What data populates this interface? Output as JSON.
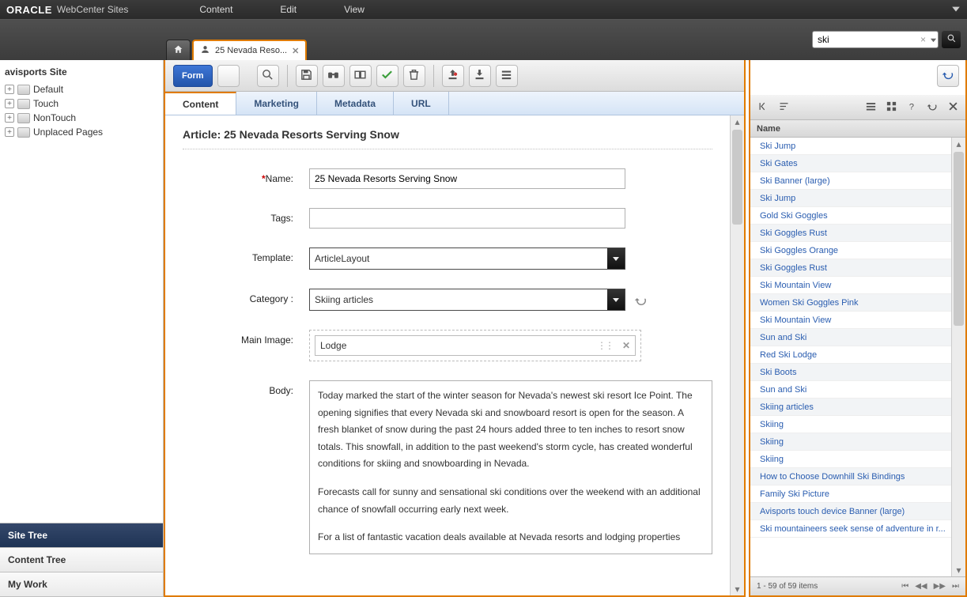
{
  "brand": "ORACLE",
  "brandSub": "WebCenter Sites",
  "topMenu": [
    "Content",
    "Edit",
    "View"
  ],
  "search": {
    "value": "ski"
  },
  "tabs": {
    "active": "25 Nevada Reso..."
  },
  "sidebar": {
    "siteTitle": "avisports Site",
    "nodes": [
      "Default",
      "Touch",
      "NonTouch",
      "Unplaced Pages"
    ],
    "sections": [
      "Site Tree",
      "Content Tree",
      "My Work"
    ],
    "activeSection": 0
  },
  "toolbar": {
    "formBtn": "Form"
  },
  "subtabs": [
    "Content",
    "Marketing",
    "Metadata",
    "URL"
  ],
  "form": {
    "heading": "Article: 25 Nevada Resorts Serving Snow",
    "labels": {
      "name": "Name:",
      "tags": "Tags:",
      "template": "Template:",
      "category": "Category :",
      "mainImage": "Main Image:",
      "body": "Body:"
    },
    "name": "25 Nevada Resorts Serving Snow",
    "tags": "",
    "template": "ArticleLayout",
    "category": "Skiing articles",
    "mainImage": "Lodge",
    "bodyP1": "Today marked the start of the winter season for Nevada's newest ski resort Ice Point. The opening signifies that every Nevada ski and snowboard resort is open for the season. A fresh blanket of snow during the past 24 hours added three to ten inches to resort snow totals. This snowfall, in addition to the past weekend's storm cycle, has created wonderful conditions for skiing and snowboarding in Nevada.",
    "bodyP2": "Forecasts call for sunny and sensational ski conditions over the weekend with an additional chance of snowfall occurring early next week.",
    "bodyP3": "For a list of fantastic vacation deals available at Nevada resorts and lodging properties"
  },
  "results": {
    "header": "Name",
    "items": [
      "Ski Jump",
      "Ski Gates",
      "Ski Banner (large)",
      "Ski Jump",
      "Gold Ski Goggles",
      "Ski Goggles Rust",
      "Ski Goggles Orange",
      "Ski Goggles Rust",
      "Ski Mountain View",
      "Women Ski Goggles Pink",
      "Ski Mountain View",
      "Sun and Ski",
      "Red Ski Lodge",
      "Ski Boots",
      "Sun and Ski",
      "Skiing articles",
      "Skiing",
      "Skiing",
      "Skiing",
      "How to Choose Downhill Ski Bindings",
      "Family Ski Picture",
      "Avisports touch device Banner (large)",
      "Ski mountaineers seek sense of adventure in r..."
    ],
    "footer": "1 - 59 of 59 items"
  }
}
